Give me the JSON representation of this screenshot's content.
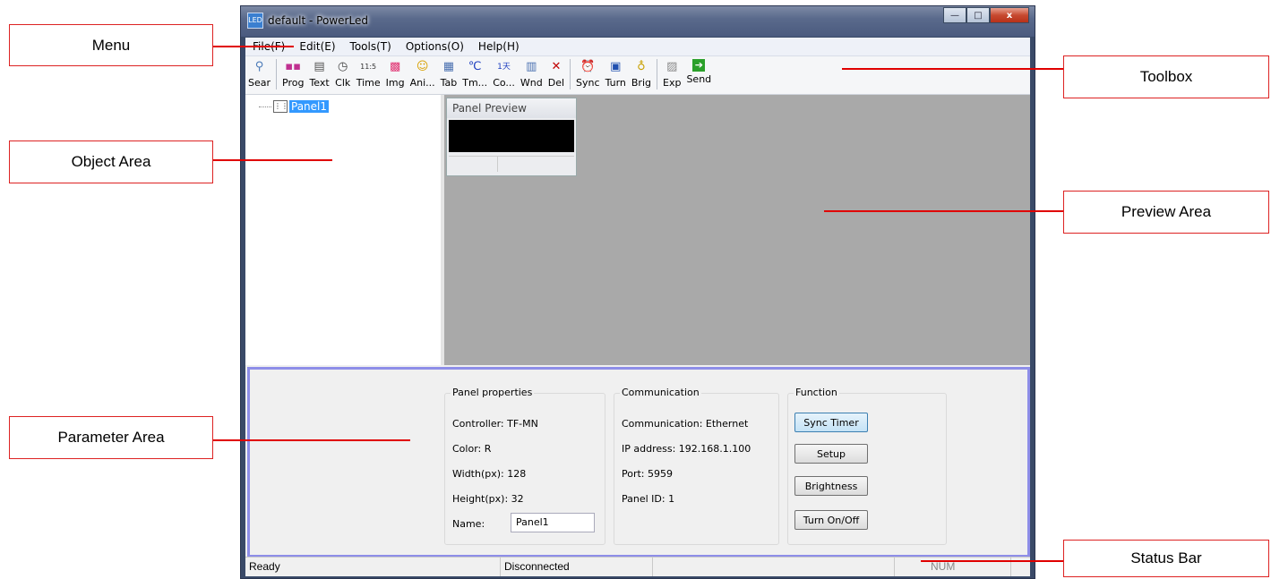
{
  "window": {
    "title": "default - PowerLed",
    "app_icon": "LED"
  },
  "window_controls": {
    "minimize": "—",
    "maximize": "□",
    "close": "x"
  },
  "menu": [
    "File(F)",
    "Edit(E)",
    "Tools(T)",
    "Options(O)",
    "Help(H)"
  ],
  "toolbar": [
    {
      "label": "Sear",
      "icon": "search-icon"
    },
    {
      "label": "Prog",
      "icon": "program-icon"
    },
    {
      "label": "Text",
      "icon": "text-icon"
    },
    {
      "label": "Clk",
      "icon": "clock-icon"
    },
    {
      "label": "Time",
      "icon": "time-icon"
    },
    {
      "label": "Img",
      "icon": "image-icon"
    },
    {
      "label": "Ani...",
      "icon": "animation-icon"
    },
    {
      "label": "Tab",
      "icon": "table-icon"
    },
    {
      "label": "Tm...",
      "icon": "temperature-icon"
    },
    {
      "label": "Co...",
      "icon": "countdown-icon"
    },
    {
      "label": "Wnd",
      "icon": "window-icon"
    },
    {
      "label": "Del",
      "icon": "delete-icon"
    },
    {
      "label": "Sync",
      "icon": "sync-icon"
    },
    {
      "label": "Turn",
      "icon": "turn-icon"
    },
    {
      "label": "Brig",
      "icon": "brightness-icon"
    },
    {
      "label": "Exp",
      "icon": "export-icon"
    },
    {
      "label": "Send",
      "icon": "send-icon"
    }
  ],
  "tree": {
    "node": "Panel1"
  },
  "preview": {
    "title": "Panel Preview"
  },
  "panel_props": {
    "title": "Panel properties",
    "controller": "Controller: TF-MN",
    "color": "Color: R",
    "width": "Width(px): 128",
    "height": "Height(px): 32",
    "name_label": "Name:",
    "name_value": "Panel1"
  },
  "communication": {
    "title": "Communication",
    "type": "Communication: Ethernet",
    "ip": "IP address: 192.168.1.100",
    "port": "Port: 5959",
    "panel_id": "Panel ID: 1"
  },
  "function": {
    "title": "Function",
    "sync": "Sync Timer",
    "setup": "Setup",
    "brightness": "Brightness",
    "turn": "Turn On/Off"
  },
  "status": {
    "ready": "Ready",
    "conn": "Disconnected",
    "num": "NUM"
  },
  "callouts": {
    "menu": "Menu",
    "toolbox": "Toolbox",
    "object": "Object Area",
    "preview": "Preview Area",
    "param": "Parameter Area",
    "status": "Status Bar"
  },
  "colors": {
    "callout_line": "#e00000",
    "param_border": "#8e8ee8",
    "selection": "#3399ff"
  }
}
